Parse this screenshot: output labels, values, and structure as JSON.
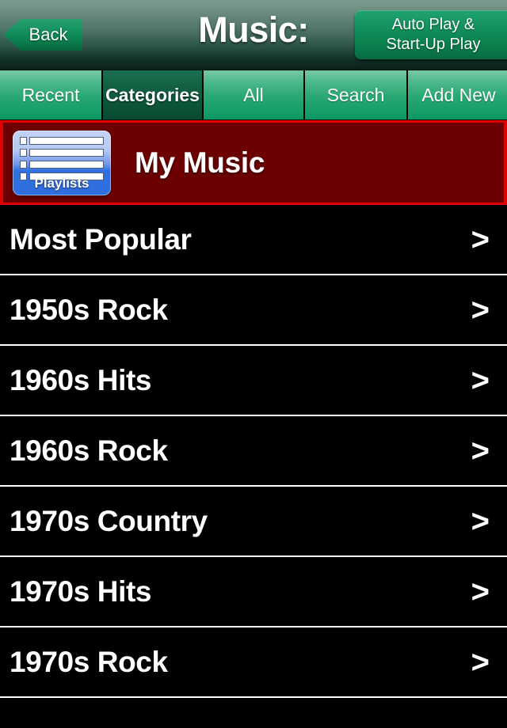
{
  "header": {
    "title": "Music:",
    "back_label": "Back",
    "autoplay_line1": "Auto Play &",
    "autoplay_line2": "Start-Up Play"
  },
  "tabs": [
    {
      "label": "Recent",
      "active": false
    },
    {
      "label": "Categories",
      "active": true
    },
    {
      "label": "All",
      "active": false
    },
    {
      "label": "Search",
      "active": false
    },
    {
      "label": "Add New",
      "active": false
    }
  ],
  "banner": {
    "title": "My Music",
    "icon_label": "Playlists",
    "border_color": "#e00000",
    "background_color": "#6d0000"
  },
  "list": {
    "chevron": ">",
    "items": [
      {
        "label": "Most Popular"
      },
      {
        "label": "1950s Rock"
      },
      {
        "label": "1960s Hits"
      },
      {
        "label": "1960s Rock"
      },
      {
        "label": "1970s Country"
      },
      {
        "label": "1970s Hits"
      },
      {
        "label": "1970s Rock"
      }
    ]
  },
  "theme": {
    "accent_green": "#0c8450",
    "tab_active_green": "#0c5539",
    "list_background": "#000000",
    "list_text": "#ffffff"
  }
}
